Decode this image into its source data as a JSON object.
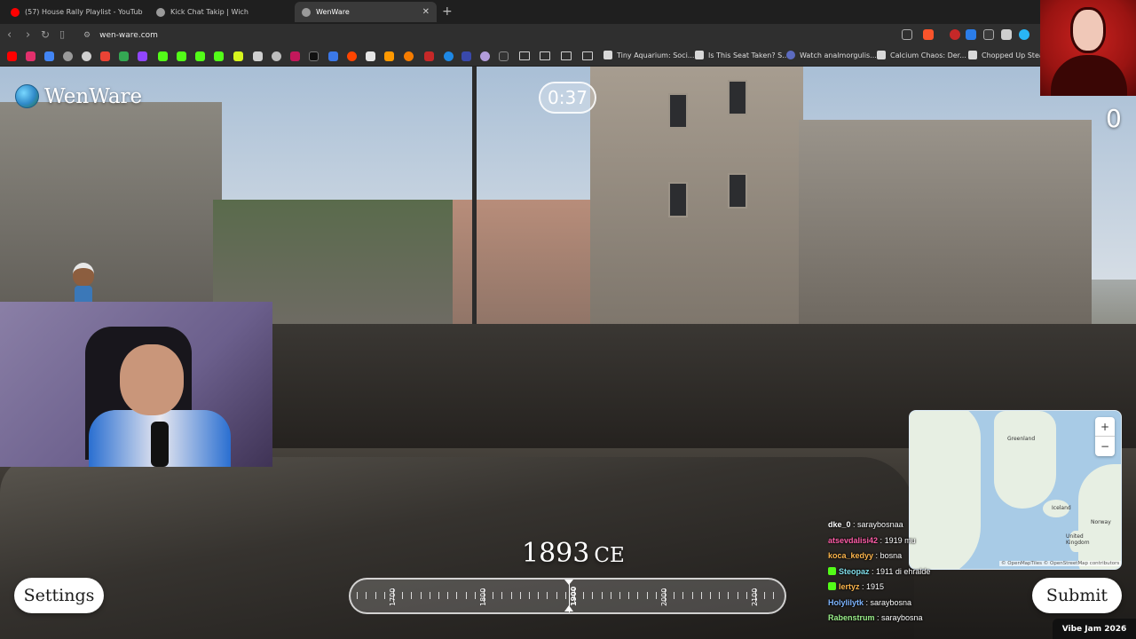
{
  "browser": {
    "tabs": [
      {
        "title": "(57) House Rally Playlist - YouTub",
        "favicon_color": "#ff0000",
        "active": false
      },
      {
        "title": "Kick Chat Takip | Wich",
        "favicon_color": "#9a9a9a",
        "active": false
      },
      {
        "title": "WenWare",
        "favicon_color": "#9a9a9a",
        "active": true
      }
    ],
    "new_tab_symbol": "+",
    "close_symbol": "✕",
    "url": "wen-ware.com",
    "bookmarks": [
      {
        "label": "Tiny Aquarium: Soci..."
      },
      {
        "label": "Is This Seat Taken? S..."
      },
      {
        "label": "Watch analmorgulis..."
      },
      {
        "label": "Calcium Chaos: Der..."
      },
      {
        "label": "Chopped Up Steam"
      }
    ]
  },
  "game": {
    "logo_text": "WenWare",
    "timer": "0:37",
    "score": "0",
    "year": "1893",
    "era": "CE",
    "settings_label": "Settings",
    "submit_label": "Submit",
    "slider": {
      "selected_year": 1900,
      "tick_labels": [
        "1700",
        "1800",
        "1900",
        "2000",
        "2100"
      ]
    }
  },
  "map": {
    "labels": [
      "Greenland",
      "Iceland",
      "Norway",
      "United Kingdom"
    ],
    "zoom_in": "+",
    "zoom_out": "−",
    "attribution": "© OpenMapTiles © OpenStreetMap contributors"
  },
  "chat": [
    {
      "user": "dke_0",
      "message": "saraybosnaa",
      "user_color": "#ffffff",
      "badge": false
    },
    {
      "user": "atsevdalisi42",
      "message": "1919 mu",
      "user_color": "#ff5ea8",
      "badge": false
    },
    {
      "user": "koca_kedyy",
      "message": "bosna",
      "user_color": "#ffb74d",
      "badge": false
    },
    {
      "user": "Steopaz",
      "message": "1911 di ehralde",
      "user_color": "#80deea",
      "badge": true
    },
    {
      "user": "lertyz",
      "message": "1915",
      "user_color": "#ffb74d",
      "badge": true
    },
    {
      "user": "Holylilytk",
      "message": "saraybosna",
      "user_color": "#7fb6ff",
      "badge": false
    },
    {
      "user": "Rabenstrum",
      "message": "saraybosna",
      "user_color": "#9cf08b",
      "badge": false
    }
  ],
  "vibe_jam_label": "Vibe Jam 2026",
  "colors": {
    "accent_white": "#ffffff",
    "chrome_dark": "#1f1f1f",
    "map_water": "#a8cbe6"
  }
}
